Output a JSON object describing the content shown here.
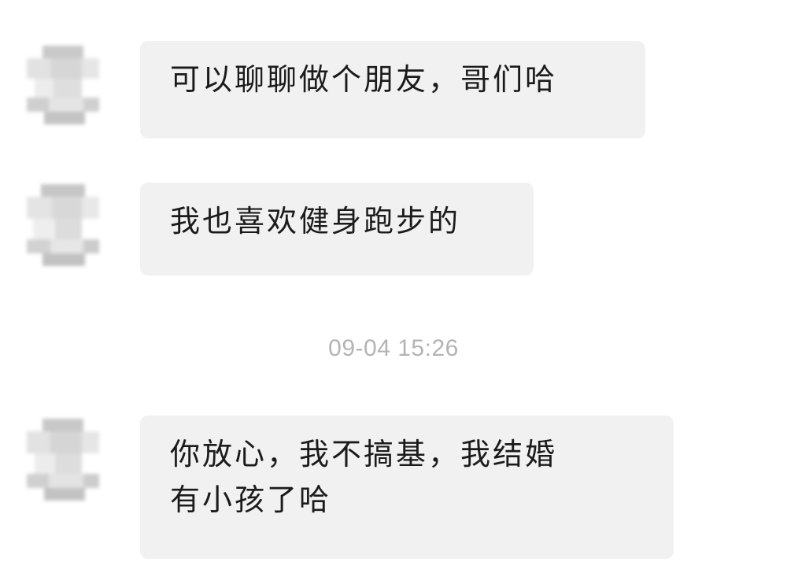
{
  "conversation": {
    "messages": [
      {
        "text": "可以聊聊做个朋友，哥们哈"
      },
      {
        "text": "我也喜欢健身跑步的"
      },
      {
        "text": "你放心，我不搞基，我结婚\n有小孩了哈"
      }
    ],
    "timestamp": "09-04 15:26"
  },
  "style": {
    "bubble_color": "#f1f1f1",
    "text_color": "#1b1b1b",
    "timestamp_color": "#b4b4b4",
    "background": "#ffffff"
  },
  "icons": {
    "avatar": "pixelated-avatar-icon"
  }
}
